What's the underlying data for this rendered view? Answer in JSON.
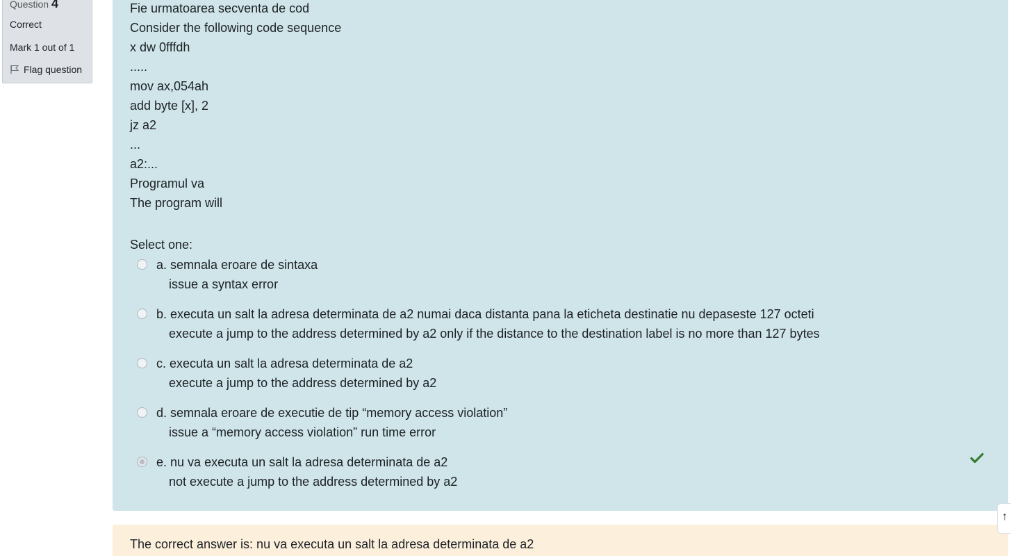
{
  "info": {
    "question_label": "Question",
    "question_number": "4",
    "state": "Correct",
    "grade": "Mark 1 out of 1",
    "flag_label": "Flag question"
  },
  "question": {
    "lines": [
      "Fie urmatoarea secventa de cod",
      "Consider the following code sequence",
      "x dw 0fffdh",
      ".....",
      "mov ax,054ah",
      "add byte [x], 2",
      "jz a2",
      "...",
      "a2:...",
      "Programul va",
      "The program will"
    ],
    "prompt": "Select one:"
  },
  "options": [
    {
      "letter": "a.",
      "text": "semnala eroare de sintaxa",
      "translation": "issue a syntax error",
      "checked": false
    },
    {
      "letter": "b.",
      "text": "executa un salt la adresa determinata de a2 numai daca distanta pana la eticheta destinatie nu depaseste 127 octeti",
      "translation": "execute a jump to the address determined by a2 only if the distance to the destination label is no more than 127 bytes",
      "checked": false
    },
    {
      "letter": "c.",
      "text": "executa un salt la adresa determinata de a2",
      "translation": "execute a jump to the address determined by a2",
      "checked": false
    },
    {
      "letter": "d.",
      "text": "semnala eroare de executie de tip “memory access violation”",
      "translation": "issue a “memory access violation” run time error",
      "checked": false
    },
    {
      "letter": "e.",
      "text": "nu va executa un salt la adresa determinata de a2",
      "translation": "not execute a jump to the address determined by a2",
      "checked": true,
      "correct": true
    }
  ],
  "feedback": {
    "right_answer": "The correct answer is: nu va executa un salt la adresa determinata de a2"
  },
  "colors": {
    "formulation_bg": "#cfe5e9",
    "feedback_bg": "#fcefdc",
    "info_bg": "#dee2e6",
    "correct_icon": "#357a32"
  },
  "icons": {
    "flag": "flag-icon",
    "correct": "check-icon",
    "scroll_top": "arrow-up-icon"
  }
}
